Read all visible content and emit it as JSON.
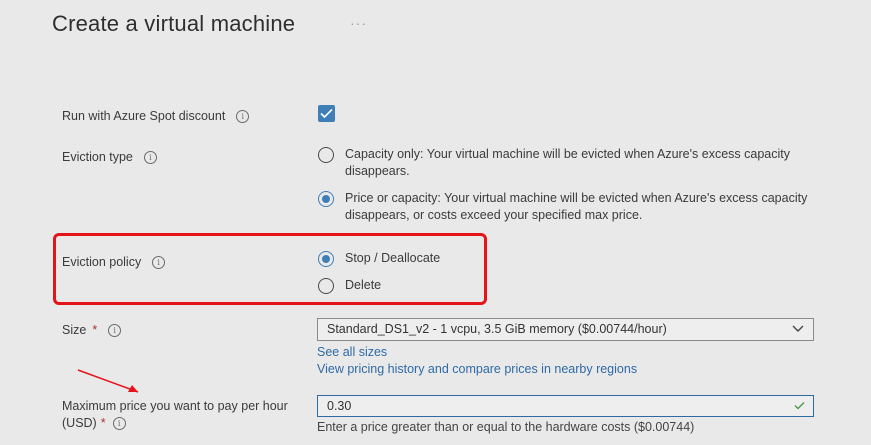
{
  "page": {
    "title": "Create a virtual machine",
    "more_label": "···"
  },
  "spot": {
    "label": "Run with Azure Spot discount",
    "checked": true
  },
  "eviction_type": {
    "label": "Eviction type",
    "options": [
      {
        "label": "Capacity only: Your virtual machine will be evicted when Azure's excess capacity disappears.",
        "selected": false
      },
      {
        "label": "Price or capacity: Your virtual machine will be evicted when Azure's excess capacity disappears, or costs exceed your specified max price.",
        "selected": true
      }
    ]
  },
  "eviction_policy": {
    "label": "Eviction policy",
    "options": [
      {
        "label": "Stop / Deallocate",
        "selected": true
      },
      {
        "label": "Delete",
        "selected": false
      }
    ]
  },
  "size": {
    "label": "Size",
    "required_mark": "*",
    "value": "Standard_DS1_v2 - 1 vcpu, 3.5 GiB memory ($0.00744/hour)",
    "see_all_link": "See all sizes",
    "pricing_link": "View pricing history and compare prices in nearby regions"
  },
  "max_price": {
    "label_line1": "Maximum price you want to pay per hour",
    "label_line2": "(USD)",
    "required_mark": "*",
    "value": "0.30",
    "hint": "Enter a price greater than or equal to the hardware costs ($0.00744)"
  },
  "colors": {
    "accent": "#3f7fb8",
    "highlight": "#e5141b",
    "link": "#2f6aa5"
  },
  "icons": {
    "info": "info-icon",
    "check": "checkmark-icon",
    "chevron": "chevron-down-icon",
    "arrow": "red-arrow-annotation"
  }
}
